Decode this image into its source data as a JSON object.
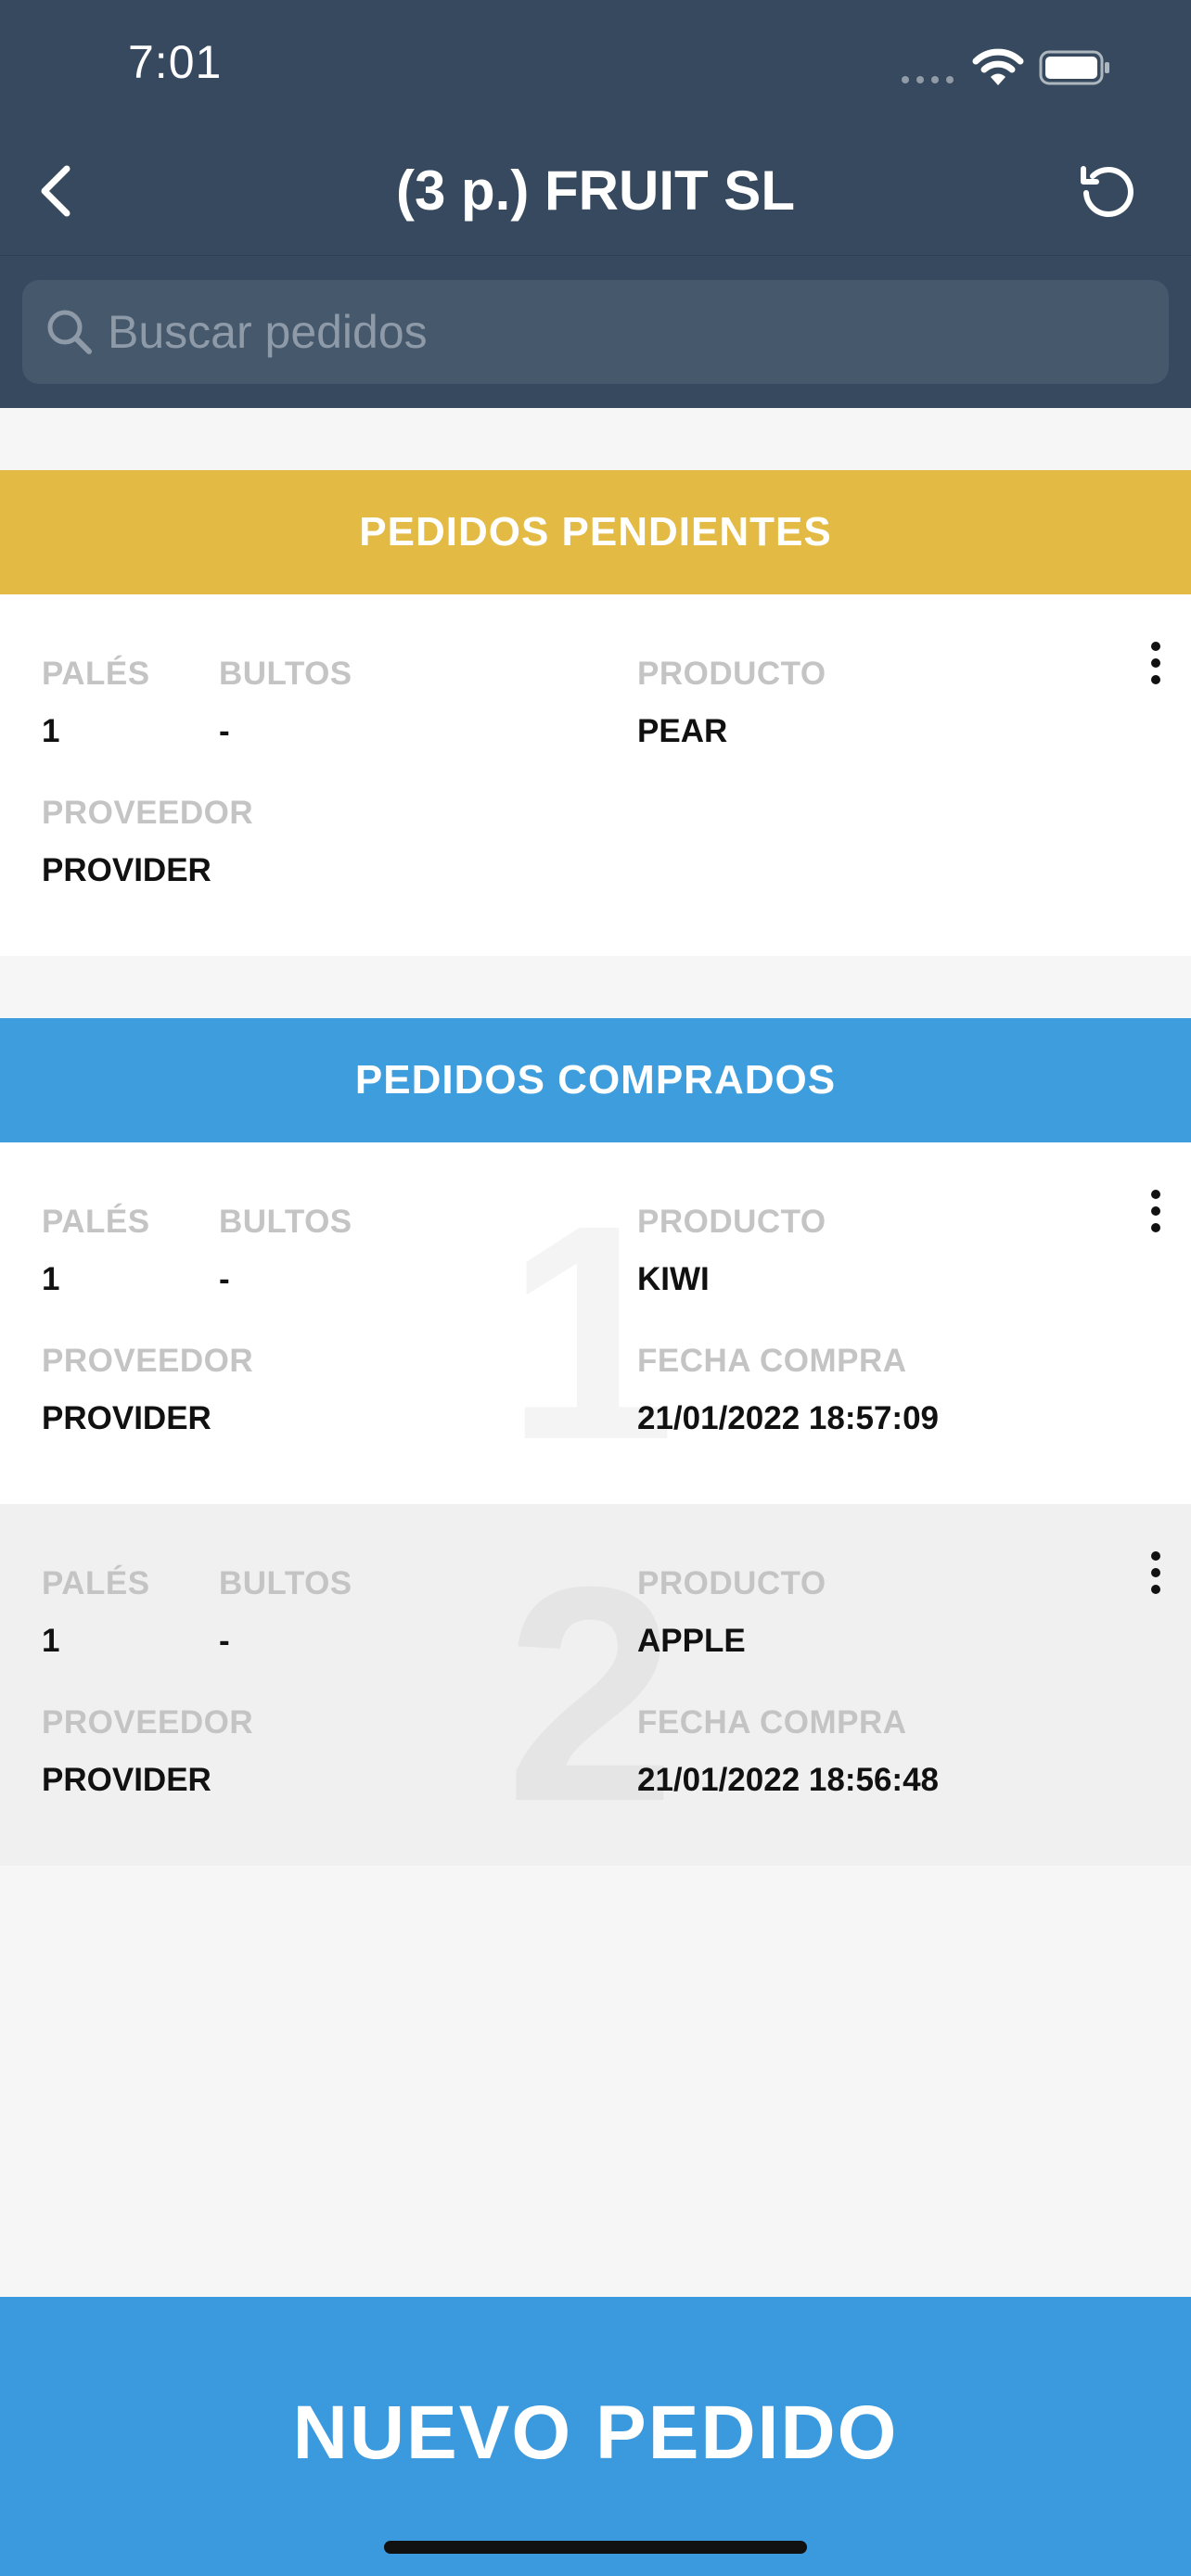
{
  "status_bar": {
    "time": "7:01"
  },
  "header": {
    "title": "(3 p.) FRUIT SL"
  },
  "search": {
    "placeholder": "Buscar pedidos"
  },
  "sections": {
    "pending": {
      "title": "PEDIDOS PENDIENTES",
      "color": "#e3bb44",
      "items": [
        {
          "pales_label": "PALÉS",
          "pales": "1",
          "bultos_label": "BULTOS",
          "bultos": "-",
          "producto_label": "PRODUCTO",
          "producto": "PEAR",
          "proveedor_label": "PROVEEDOR",
          "proveedor": "PROVIDER"
        }
      ]
    },
    "bought": {
      "title": "PEDIDOS COMPRADOS",
      "color": "#3e9ddc",
      "items": [
        {
          "number": "1",
          "pales_label": "PALÉS",
          "pales": "1",
          "bultos_label": "BULTOS",
          "bultos": "-",
          "producto_label": "PRODUCTO",
          "producto": "KIWI",
          "proveedor_label": "PROVEEDOR",
          "proveedor": "PROVIDER",
          "fecha_label": "FECHA COMPRA",
          "fecha": "21/01/2022 18:57:09"
        },
        {
          "number": "2",
          "pales_label": "PALÉS",
          "pales": "1",
          "bultos_label": "BULTOS",
          "bultos": "-",
          "producto_label": "PRODUCTO",
          "producto": "APPLE",
          "proveedor_label": "PROVEEDOR",
          "proveedor": "PROVIDER",
          "fecha_label": "FECHA COMPRA",
          "fecha": "21/01/2022 18:56:48"
        }
      ]
    }
  },
  "bottom_button": {
    "label": "NUEVO PEDIDO",
    "color": "#3b9ade"
  },
  "icons": {
    "back": "chevron-left-icon",
    "refresh": "refresh-icon",
    "search": "search-icon",
    "more": "more-vertical-icon"
  }
}
